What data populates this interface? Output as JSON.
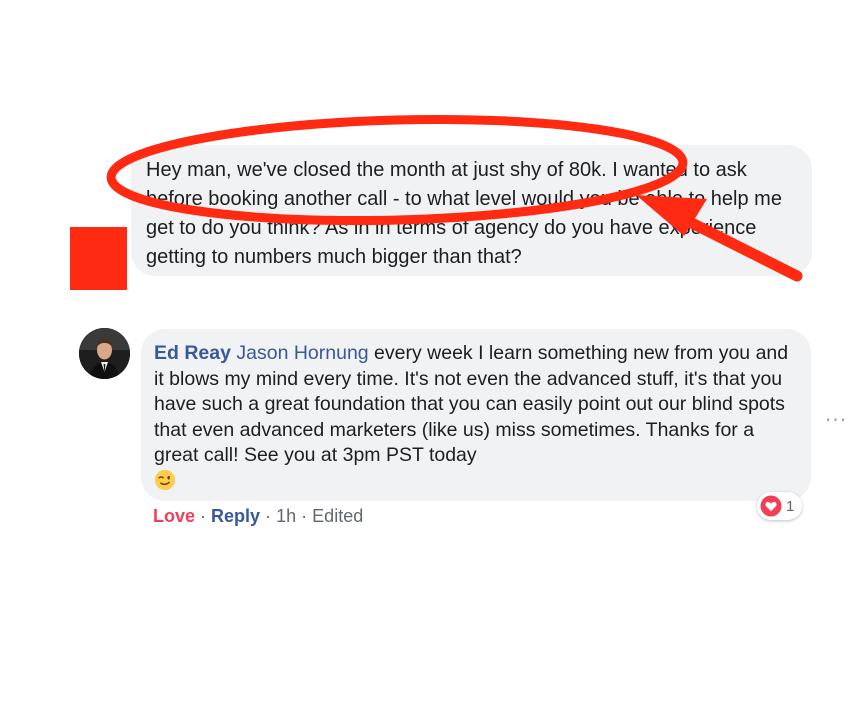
{
  "message_bubble": {
    "text": "Hey man, we've closed the month at just shy of 80k. I wanted to ask before booking another call - to what level would you be able to help me get to do you think? As in in terms of agency do you have experience getting to numbers much bigger than that?"
  },
  "comment": {
    "author": "Ed Reay",
    "tagged_name": "Jason Hornung",
    "text": " every week I learn something new from you and it blows my mind every time. It's not even the advanced stuff, it's that you have such a great foundation that you can easily point out our blind spots that even advanced marketers (like us) miss sometimes. Thanks for a great call! See you at 3pm PST today",
    "emoji": "winking-face-emoji",
    "actions": {
      "love_label": "Love",
      "separator": "·",
      "reply_label": "Reply",
      "time": "1h",
      "edited_label": "Edited"
    },
    "reaction": {
      "icon": "heart-reaction-icon",
      "count": "1"
    }
  },
  "more_options_label": "···",
  "colors": {
    "annotation_red": "#ff2a12",
    "link_blue": "#385898",
    "love_pink": "#f33e58",
    "bubble_gray": "#f1f2f4"
  }
}
